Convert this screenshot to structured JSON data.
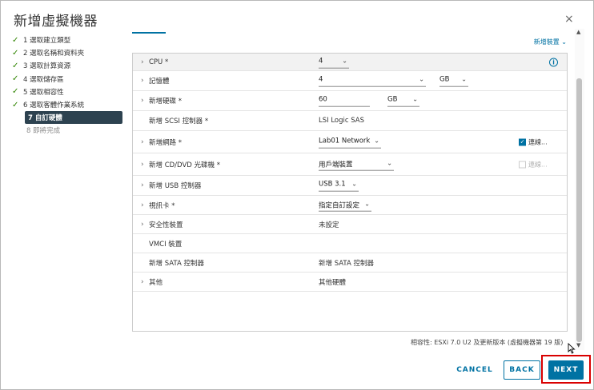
{
  "dialog": {
    "title": "新增虛擬機器",
    "close_glyph": "×"
  },
  "steps": [
    {
      "label": "1 選取建立類型",
      "state": "done"
    },
    {
      "label": "2 選取名稱和資料夾",
      "state": "done"
    },
    {
      "label": "3 選取計算資源",
      "state": "done"
    },
    {
      "label": "4 選取儲存區",
      "state": "done"
    },
    {
      "label": "5 選取相容性",
      "state": "done"
    },
    {
      "label": "6 選取客體作業系統",
      "state": "done"
    },
    {
      "label": "7 自訂硬體",
      "state": "active"
    },
    {
      "label": "8 即將完成",
      "state": "todo"
    }
  ],
  "content": {
    "add_device_label": "新增裝置"
  },
  "hardware": {
    "cpu": {
      "label": "CPU *",
      "value": "4"
    },
    "memory": {
      "label": "記憶體",
      "value": "4",
      "unit": "GB"
    },
    "disk": {
      "label": "新增硬碟 *",
      "value": "60",
      "unit": "GB"
    },
    "scsi": {
      "label": "新增 SCSI 控制器 *",
      "value": "LSI Logic SAS"
    },
    "network": {
      "label": "新增網路 *",
      "value": "Lab01 Network",
      "connect_label": "連線..."
    },
    "cdrom": {
      "label": "新增 CD/DVD 光碟機 *",
      "value": "用戶端裝置",
      "connect_label": "連線..."
    },
    "usb": {
      "label": "新增 USB 控制器",
      "value": "USB 3.1"
    },
    "video": {
      "label": "視訊卡 *",
      "value": "指定自訂設定"
    },
    "security": {
      "label": "安全性裝置",
      "value": "未設定"
    },
    "vmci": {
      "label": "VMCI 裝置"
    },
    "sata": {
      "label": "新增 SATA 控制器",
      "value": "新增 SATA 控制器"
    },
    "other": {
      "label": "其他",
      "value": "其他硬體"
    }
  },
  "compatibility": "相容性: ESXi 7.0 U2 及更新版本 (虛擬機器第 19 版)",
  "buttons": {
    "cancel": "CANCEL",
    "back": "BACK",
    "next": "NEXT"
  },
  "colors": {
    "accent": "#0072a3",
    "active_step": "#2d4250",
    "check": "#2f8400",
    "highlight": "#d90000"
  }
}
